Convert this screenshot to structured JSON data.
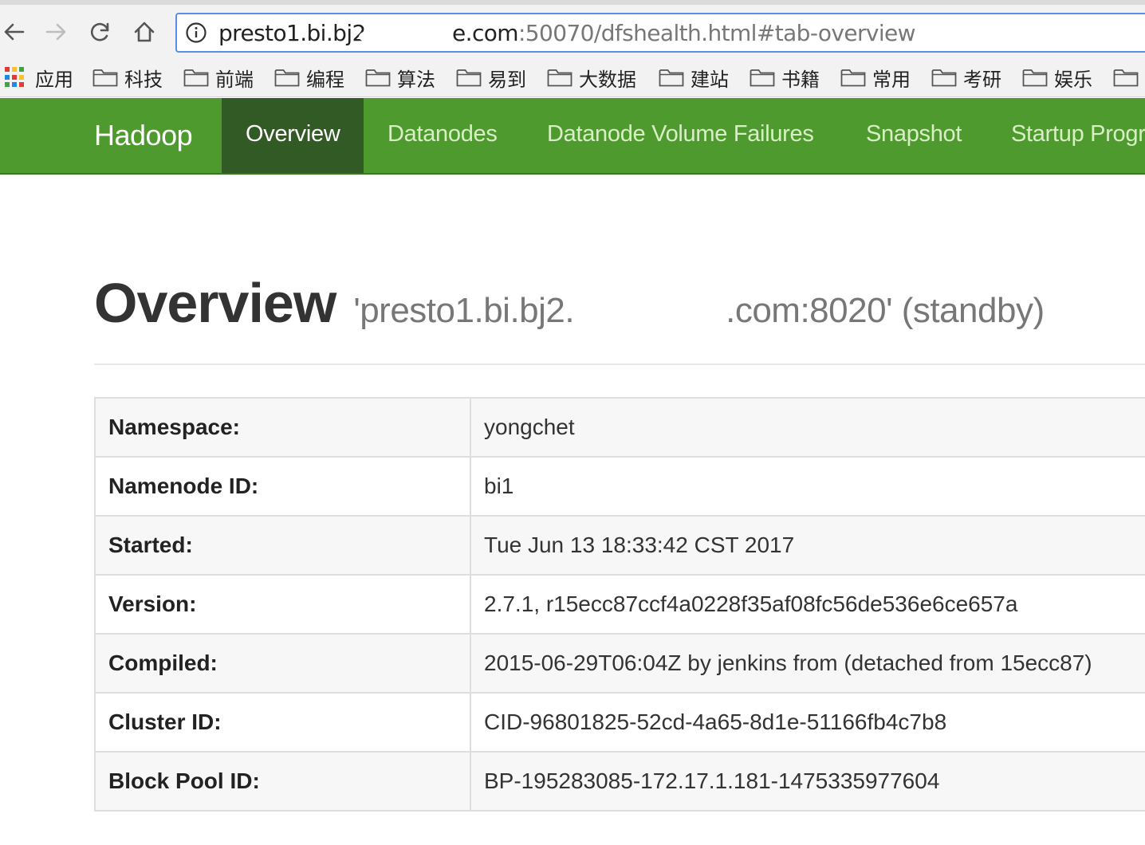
{
  "browser": {
    "url_host": "presto1.bi.bj2.",
    "url_host_tail": "e.com",
    "url_path": ":50070/dfshealth.html#tab-overview",
    "bookmarks": [
      "应用",
      "科技",
      "前端",
      "编程",
      "算法",
      "易到",
      "大数据",
      "建站",
      "书籍",
      "常用",
      "考研",
      "娱乐"
    ]
  },
  "navbar": {
    "brand": "Hadoop",
    "tabs": [
      "Overview",
      "Datanodes",
      "Datanode Volume Failures",
      "Snapshot",
      "Startup Progress"
    ],
    "active_tab": "Overview",
    "color": "#4e9a2e",
    "active_color": "#325a24"
  },
  "page": {
    "title": "Overview",
    "subtitle_head": "'presto1.bi.bj2.",
    "subtitle_tail": ".com:8020' (standby)"
  },
  "overview_table": [
    {
      "key": "Namespace:",
      "value": "yongchet"
    },
    {
      "key": "Namenode ID:",
      "value": "bi1"
    },
    {
      "key": "Started:",
      "value": "Tue Jun 13 18:33:42 CST 2017"
    },
    {
      "key": "Version:",
      "value": "2.7.1, r15ecc87ccf4a0228f35af08fc56de536e6ce657a"
    },
    {
      "key": "Compiled:",
      "value": "2015-06-29T06:04Z by jenkins from (detached from 15ecc87)"
    },
    {
      "key": "Cluster ID:",
      "value": "CID-96801825-52cd-4a65-8d1e-51166fb4c7b8"
    },
    {
      "key": "Block Pool ID:",
      "value": "BP-195283085-172.17.1.181-1475335977604"
    }
  ]
}
